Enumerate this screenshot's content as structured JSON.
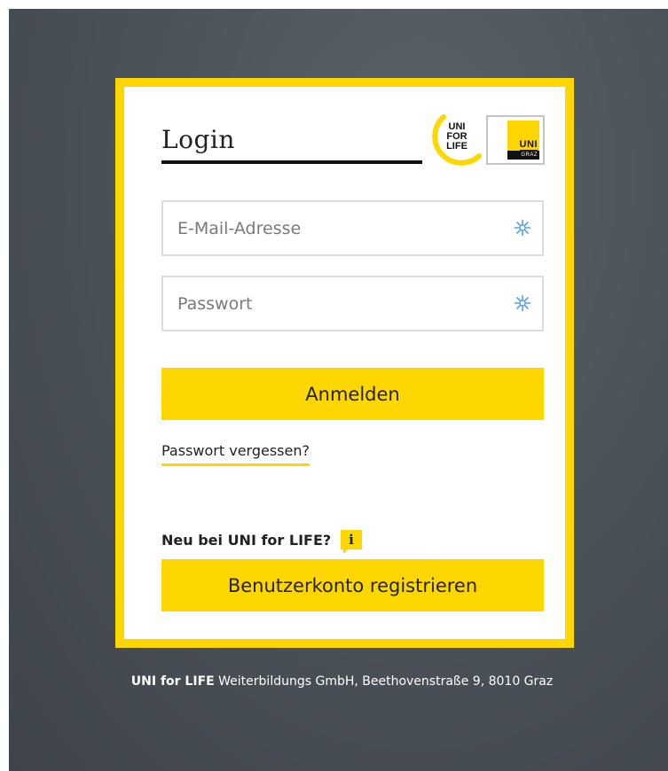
{
  "login": {
    "title": "Login",
    "logo_ufl": {
      "line1": "UNI",
      "line2": "FOR",
      "line3": "LIFE"
    },
    "logo_graz": {
      "uni": "UNI",
      "graz": "GRAZ"
    },
    "email_placeholder": "E-Mail-Adresse",
    "email_value": "",
    "password_placeholder": "Passwort",
    "password_value": "",
    "submit_label": "Anmelden",
    "forgot_label": "Passwort vergessen?",
    "new_label": "Neu bei UNI for LIFE?",
    "info_icon": "i",
    "register_label": "Benutzerkonto registrieren"
  },
  "footer": {
    "brand": "UNI for LIFE",
    "address": " Weiterbildungs GmbH, Beethovenstraße 9, 8010 Graz"
  },
  "colors": {
    "accent": "#ffd700",
    "background": "#4d535b",
    "text": "#222222"
  },
  "icons": {
    "field_icon": "keepass-snowflake-icon",
    "info": "info-icon"
  }
}
